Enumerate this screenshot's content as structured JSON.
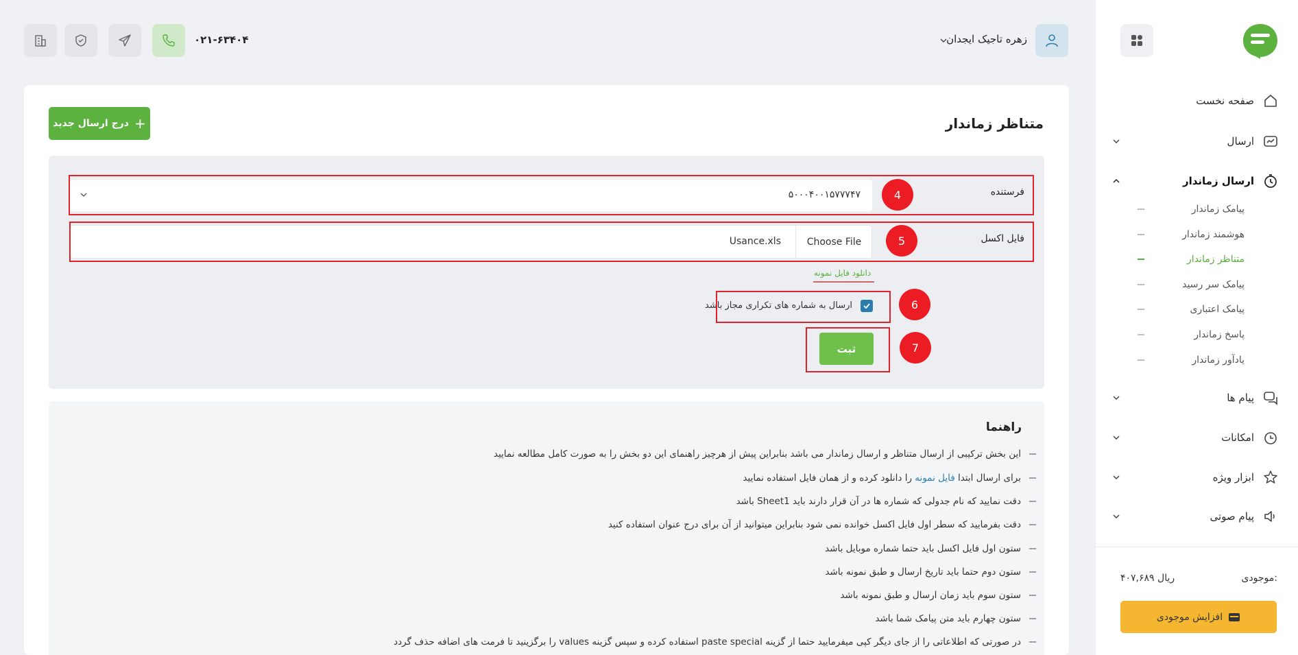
{
  "sidebar": {
    "items": [
      {
        "label": "صفحه نخست",
        "icon": "home-icon"
      },
      {
        "label": "ارسال",
        "icon": "send-chart-icon"
      },
      {
        "label": "ارسال زماندار",
        "icon": "timer-icon"
      },
      {
        "label": "پیام ها",
        "icon": "messages-icon"
      },
      {
        "label": "امکانات",
        "icon": "features-icon"
      },
      {
        "label": "ابزار ویژه",
        "icon": "star-icon"
      },
      {
        "label": "پیام صوتی",
        "icon": "speaker-icon"
      }
    ],
    "sub_items": [
      {
        "label": "پیامک زماندار"
      },
      {
        "label": "هوشمند زماندار"
      },
      {
        "label": "متناظر زماندار"
      },
      {
        "label": "پیامک سر رسید"
      },
      {
        "label": "پیامک اعتباری"
      },
      {
        "label": "پاسخ زماندار"
      },
      {
        "label": "یادآور زماندار"
      }
    ],
    "active_sub": "متناظر زماندار",
    "balance_label": "موجودی:",
    "balance_value": "۴۰۷,۶۸۹ ریال",
    "add_balance_label": "افزایش موجودی"
  },
  "header": {
    "user_name": "زهره تاجیک ایجدان",
    "phone": "۰۲۱-۶۳۴۰۴"
  },
  "main": {
    "title": "متناظر زماندار",
    "new_send_label": "درج ارسال جدید",
    "form": {
      "sender_label": "فرستنده",
      "sender_value": "۵۰۰۰۴۰۰۱۵۷۷۷۴۷",
      "excel_label": "فایل اکسل",
      "choose_file_label": "Choose File",
      "file_name": "Usance.xls",
      "download_sample": "دانلود فایل نمونه",
      "repeat_label": "ارسال به شماره های تکراری مجاز باشد",
      "repeat_checked": true,
      "submit_label": "ثبت"
    },
    "badges": [
      "4",
      "5",
      "6",
      "7"
    ],
    "guide": {
      "title": "راهنما",
      "items": [
        "این بخش ترکیبی از ارسال متناظر و ارسال زماندار می باشد بنابراین پیش از هرچیز راهنمای این دو بخش را به صورت کامل مطالعه نمایید",
        "دقت نمایید که نام جدولی که شماره ها در آن قرار دارند باید Sheet1 باشد",
        "دقت بفرمایید که سطر اول فایل اکسل خوانده نمی شود بنابراین میتوانید از آن برای درج عنوان استفاده کنید",
        "ستون اول فایل اکسل باید حتما شماره موبایل باشد",
        "ستون دوم حتما باید تاریخ ارسال و طبق نمونه باشد",
        "ستون سوم باید زمان ارسال و طبق نمونه باشد",
        "ستون چهارم باید متن پیامک شما باشد",
        "در صورتی که اطلاعاتی را از جای دیگر کپی میفرمایید حتما از گزینه paste special استفاده کرده و سپس گزینه values را برگزینید تا فرمت های اضافه حذف گردد"
      ],
      "item2_pre": "برای ارسال ابتدا",
      "item2_link": "فایل نمونه",
      "item2_post": "را دانلود کرده و از همان فایل استفاده نمایید"
    }
  },
  "colors": {
    "accent_green": "#5cb13f",
    "link_blue": "#2a7eae",
    "badge_red": "#ec1c24",
    "balance_yellow": "#f5b731"
  }
}
